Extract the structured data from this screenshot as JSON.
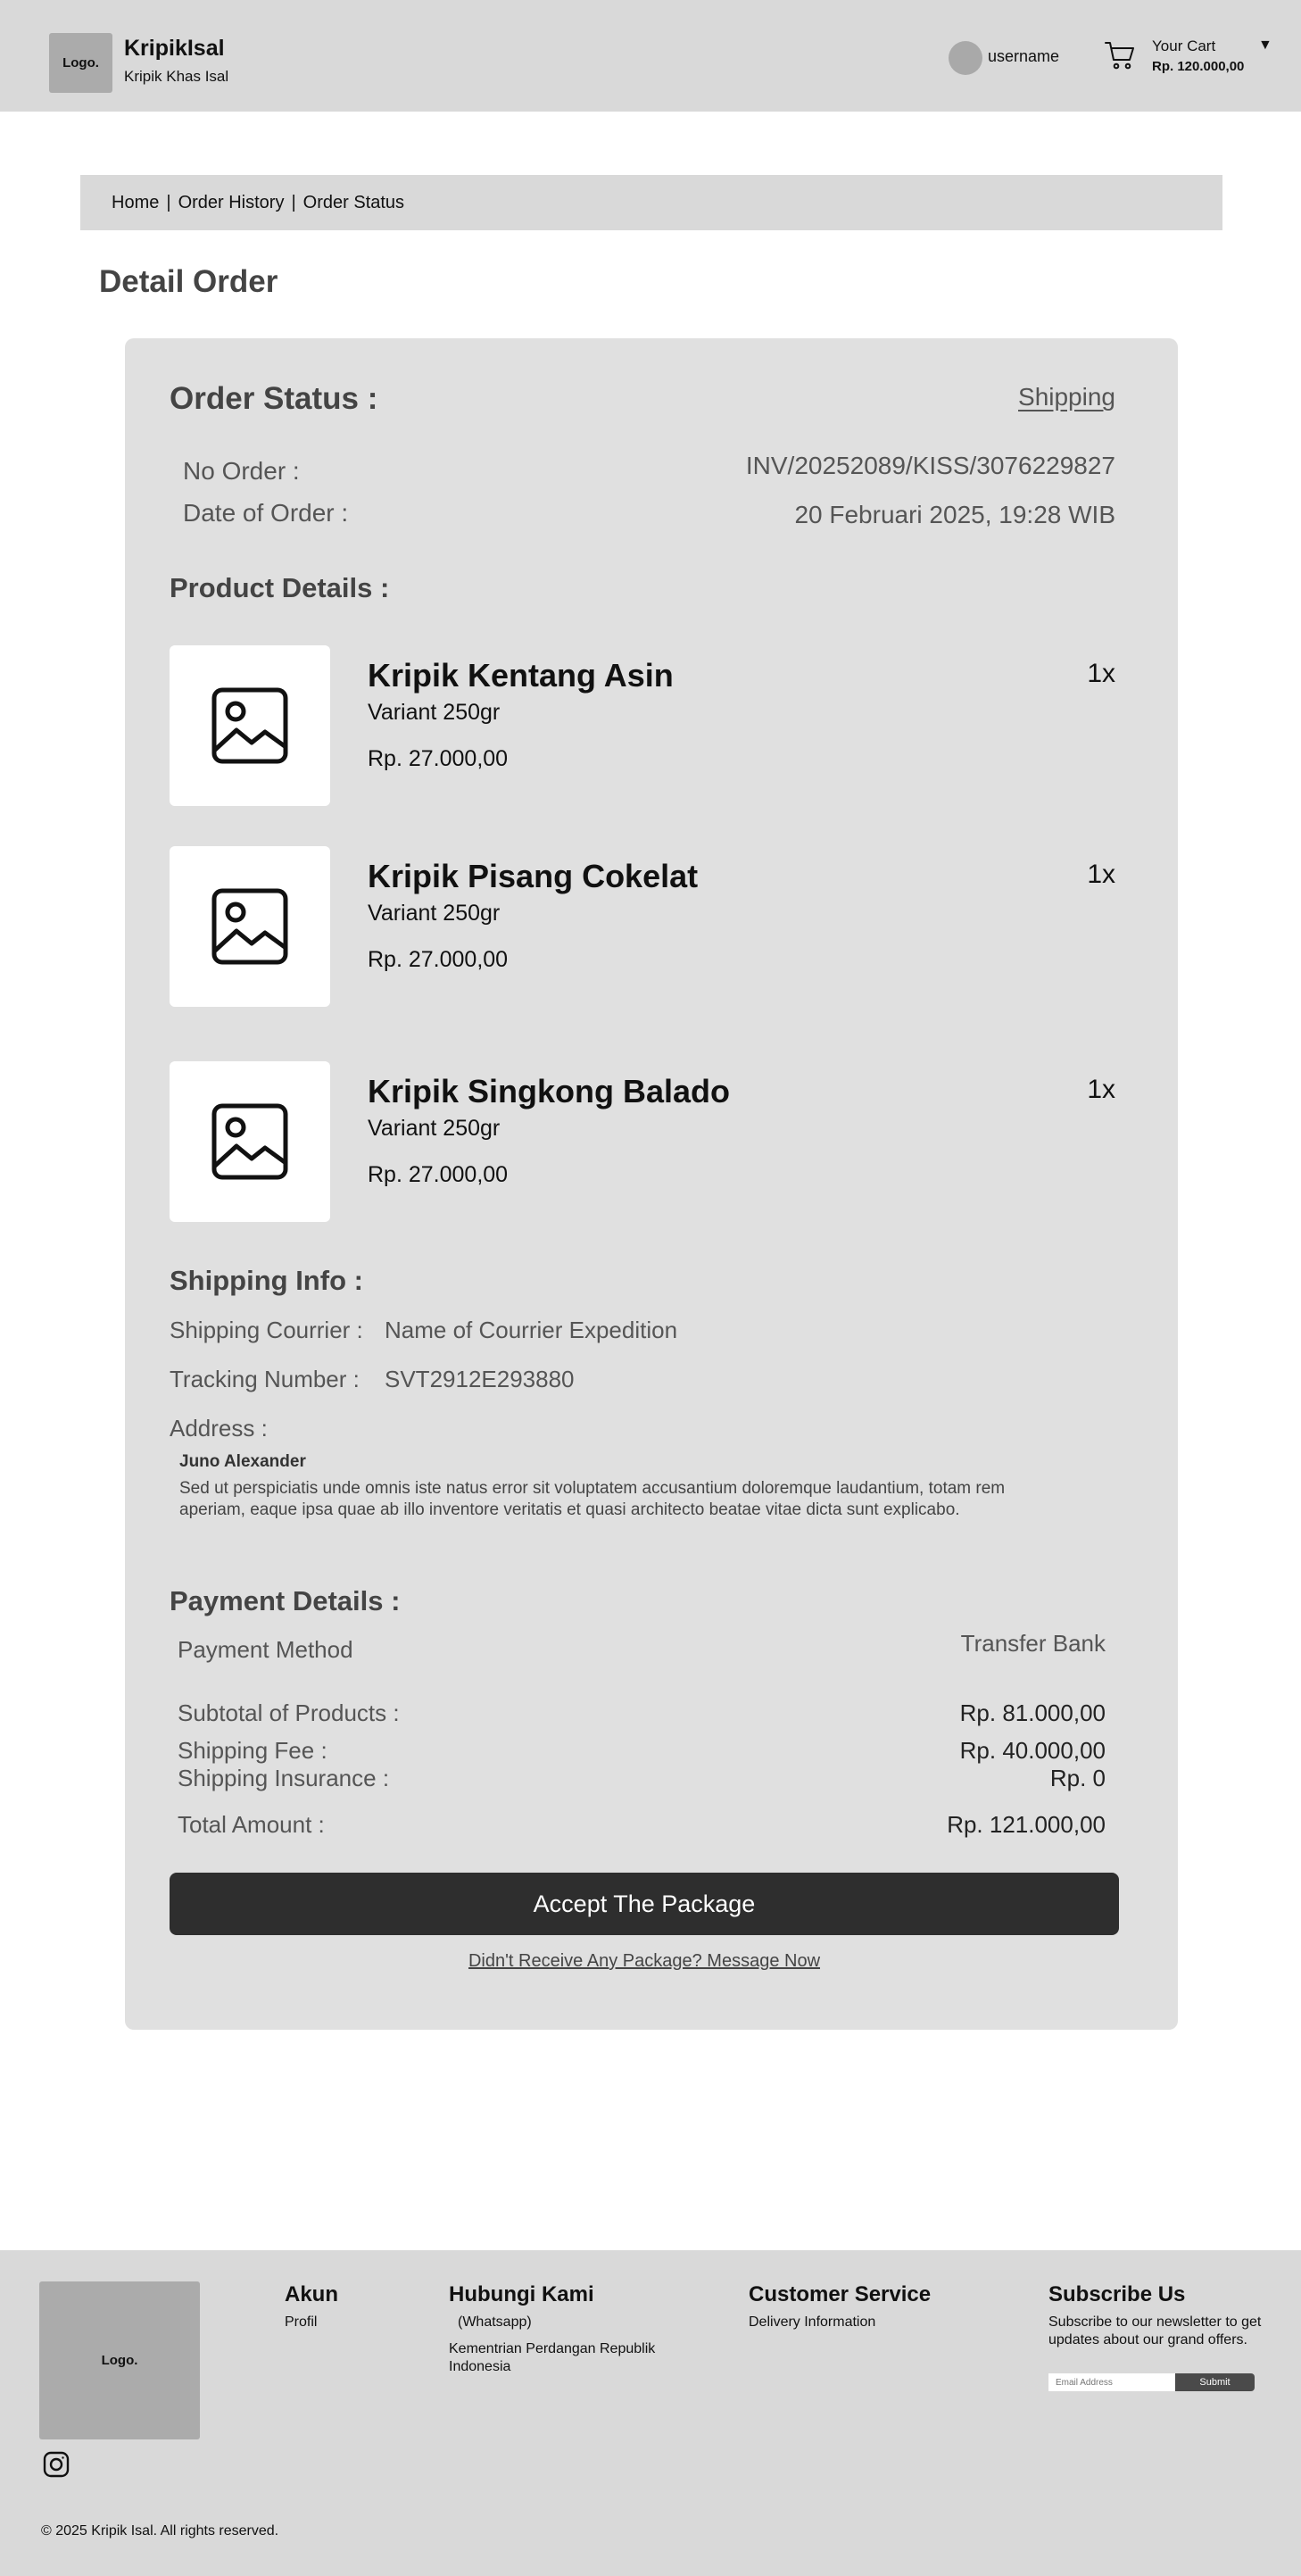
{
  "header": {
    "logo_text": "Logo.",
    "brand_name": "KripikIsal",
    "brand_tagline": "Kripik Khas Isal",
    "username": "username",
    "cart_label": "Your Cart",
    "cart_total": "Rp. 120.000,00"
  },
  "breadcrumb": {
    "items": [
      "Home",
      "Order History",
      "Order Status"
    ],
    "separator": "|"
  },
  "page_title": "Detail Order",
  "order": {
    "status_heading": "Order Status :",
    "status_value": "Shipping",
    "no_order_label": "No Order :",
    "no_order_value": "INV/20252089/KISS/3076229827",
    "date_label": "Date of Order :",
    "date_value": "20 Februari 2025, 19:28 WIB"
  },
  "products_heading": "Product Details :",
  "products": [
    {
      "name": "Kripik Kentang Asin",
      "variant": "Variant 250gr",
      "price": "Rp. 27.000,00",
      "qty": "1x"
    },
    {
      "name": "Kripik Pisang Cokelat",
      "variant": "Variant 250gr",
      "price": "Rp. 27.000,00",
      "qty": "1x"
    },
    {
      "name": "Kripik Singkong Balado",
      "variant": "Variant 250gr",
      "price": "Rp. 27.000,00",
      "qty": "1x"
    }
  ],
  "shipping": {
    "heading": "Shipping Info :",
    "courier_label": "Shipping Courrier :",
    "courier_value": "Name of Courrier Expedition",
    "tracking_label": "Tracking Number :",
    "tracking_value": "SVT2912E293880",
    "address_label": "Address :",
    "recipient": "Juno Alexander",
    "address_text": "Sed ut perspiciatis unde omnis iste natus error sit voluptatem  accusantium doloremque laudantium, totam rem aperiam, eaque ipsa quae ab illo inventore veritatis et quasi architecto beatae vitae dicta sunt explicabo."
  },
  "payment": {
    "heading": "Payment Details :",
    "method_label": "Payment Method",
    "method_value": "Transfer Bank",
    "subtotal_label": "Subtotal of Products :",
    "subtotal_value": "Rp. 81.000,00",
    "fee_label": "Shipping Fee :",
    "fee_value": "Rp. 40.000,00",
    "insurance_label": "Shipping Insurance :",
    "insurance_value": "Rp. 0",
    "total_label": "Total Amount :",
    "total_value": "Rp. 121.000,00"
  },
  "actions": {
    "accept_label": "Accept The Package",
    "no_receive_label": "Didn't Receive Any Package? Message Now"
  },
  "footer": {
    "logo_text": "Logo.",
    "akun_title": "Akun",
    "akun_profil": "Profil",
    "hubungi_title": "Hubungi Kami",
    "hubungi_whatsapp": "(Whatsapp)",
    "hubungi_address": "Kementrian Perdangan Republik Indonesia",
    "cs_title": "Customer Service",
    "cs_delivery": "Delivery Information",
    "subscribe_title": "Subscribe Us",
    "subscribe_text": "Subscribe to our newsletter to get updates about our grand offers.",
    "email_placeholder": "Email Address",
    "submit_label": "Submit",
    "copyright": "© 2025 Kripik Isal. All rights reserved."
  },
  "colors": {
    "header_bg": "#d9d9d9",
    "card_bg": "#e0e0e0",
    "button_dark": "#2e2e2e",
    "placeholder_gray": "#ababab"
  }
}
